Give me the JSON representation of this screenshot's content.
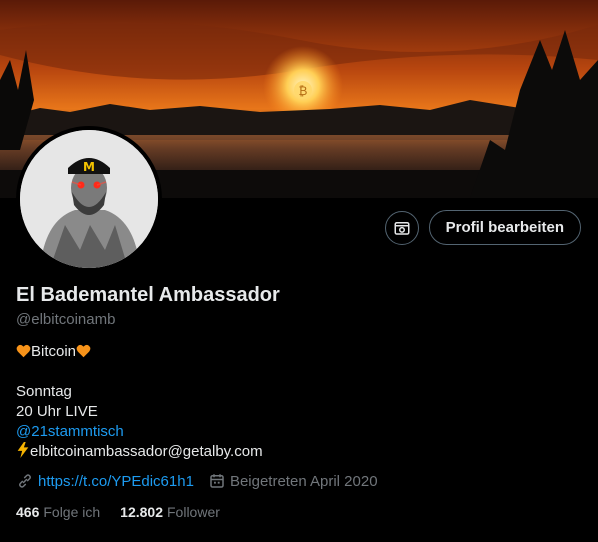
{
  "profile": {
    "name": "El Bademantel Ambassador",
    "handle": "@elbitcoinamb",
    "edit_label": "Profil bearbeiten"
  },
  "bio": {
    "line1_prefix_icon": "orange-heart-icon",
    "line1_text": "Bitcoin",
    "line1_suffix_icon": "orange-heart-icon",
    "line2": "Sonntag",
    "line3": "20 Uhr LIVE",
    "line4_mention": "@21stammtisch",
    "line5_icon": "lightning-icon",
    "line5_text": "elbitcoinambassador@getalby.com"
  },
  "meta": {
    "url": "https://t.co/YPEdic61h1",
    "joined": "Beigetreten April 2020"
  },
  "stats": {
    "following_count": "466",
    "following_label": "Folge ich",
    "followers_count": "12.802",
    "followers_label": "Follower"
  },
  "colors": {
    "accent": "#1d9bf0",
    "muted": "#71767b",
    "heart": "#f7931a",
    "lightning": "#f5b301"
  }
}
